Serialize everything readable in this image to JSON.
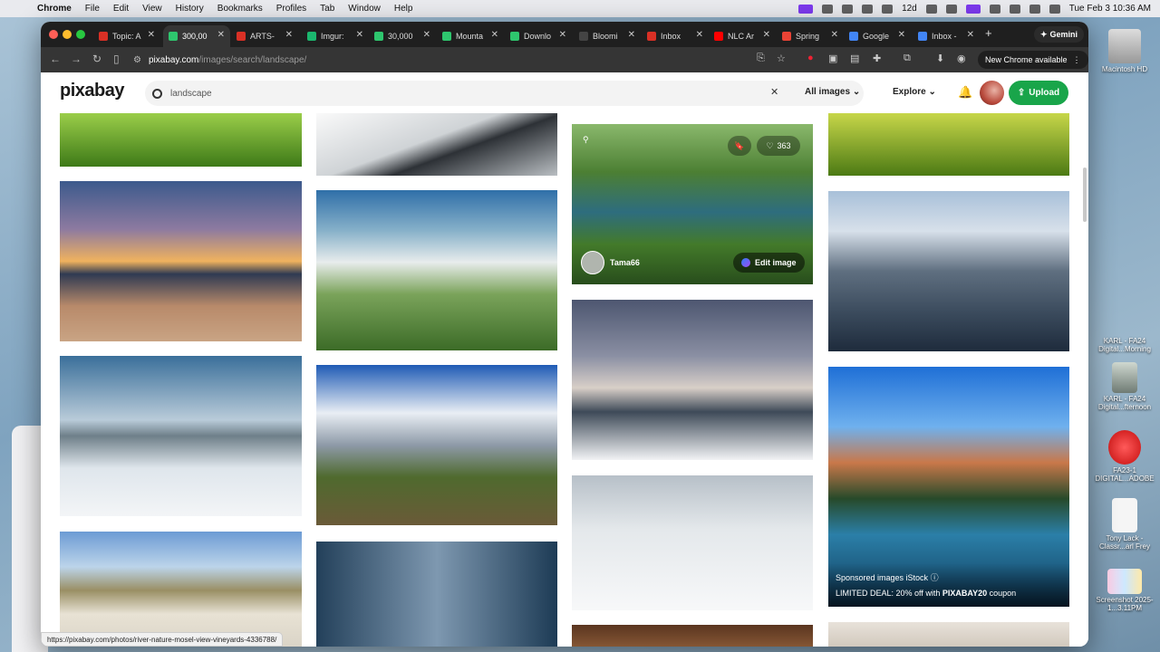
{
  "menubar": {
    "app": "Chrome",
    "items": [
      "File",
      "Edit",
      "View",
      "History",
      "Bookmarks",
      "Profiles",
      "Tab",
      "Window",
      "Help"
    ],
    "battery_badge": "12d",
    "datetime": "Tue Feb 3  10:36 AM"
  },
  "desktop": {
    "items": [
      {
        "label": "Macintosh HD"
      },
      {
        "label": "KARL - FA24 Digital...Morning"
      },
      {
        "label": "KARL - FA24 Digital...fternoon"
      },
      {
        "label": "FA23-1 DIGITAL...ADOBE"
      },
      {
        "label": "Tony Lack -Classr...arl Frey"
      },
      {
        "label": "Screenshot 2025-1...3.11PM"
      }
    ]
  },
  "browser": {
    "tabs": [
      {
        "label": "Topic: A",
        "color": "#d93025"
      },
      {
        "label": "300,00",
        "color": "#2ec66e"
      },
      {
        "label": "ARTS-",
        "color": "#d93025"
      },
      {
        "label": "Imgur:",
        "color": "#1bb76e"
      },
      {
        "label": "30,000",
        "color": "#2ec66e"
      },
      {
        "label": "Mounta",
        "color": "#2ec66e"
      },
      {
        "label": "Downlo",
        "color": "#2ec66e"
      },
      {
        "label": "Bloomi",
        "color": "#444444"
      },
      {
        "label": "Inbox",
        "color": "#d93025"
      },
      {
        "label": "NLC Ar",
        "color": "#ff0000"
      },
      {
        "label": "Spring",
        "color": "#ea4335"
      },
      {
        "label": "Google",
        "color": "#4285f4"
      },
      {
        "label": "Inbox -",
        "color": "#4285f4"
      }
    ],
    "gemini_label": "Gemini",
    "url_host": "pixabay.com",
    "url_path": "/images/search/landscape/",
    "new_chrome_label": "New Chrome available"
  },
  "page": {
    "logo": "pixabay",
    "search_value": "landscape",
    "filter_label": "All images",
    "explore_label": "Explore",
    "upload_label": "Upload",
    "hovered": {
      "likes": "363",
      "user": "Tama66",
      "edit_label": "Edit image"
    },
    "sponsored": {
      "line1": "Sponsored images iStock",
      "line2_prefix": "LIMITED DEAL: 20% off with ",
      "line2_code": "PIXABAY20",
      "line2_suffix": " coupon"
    },
    "status_url": "https://pixabay.com/photos/river-nature-mosel-view-vineyards-4336788/"
  }
}
